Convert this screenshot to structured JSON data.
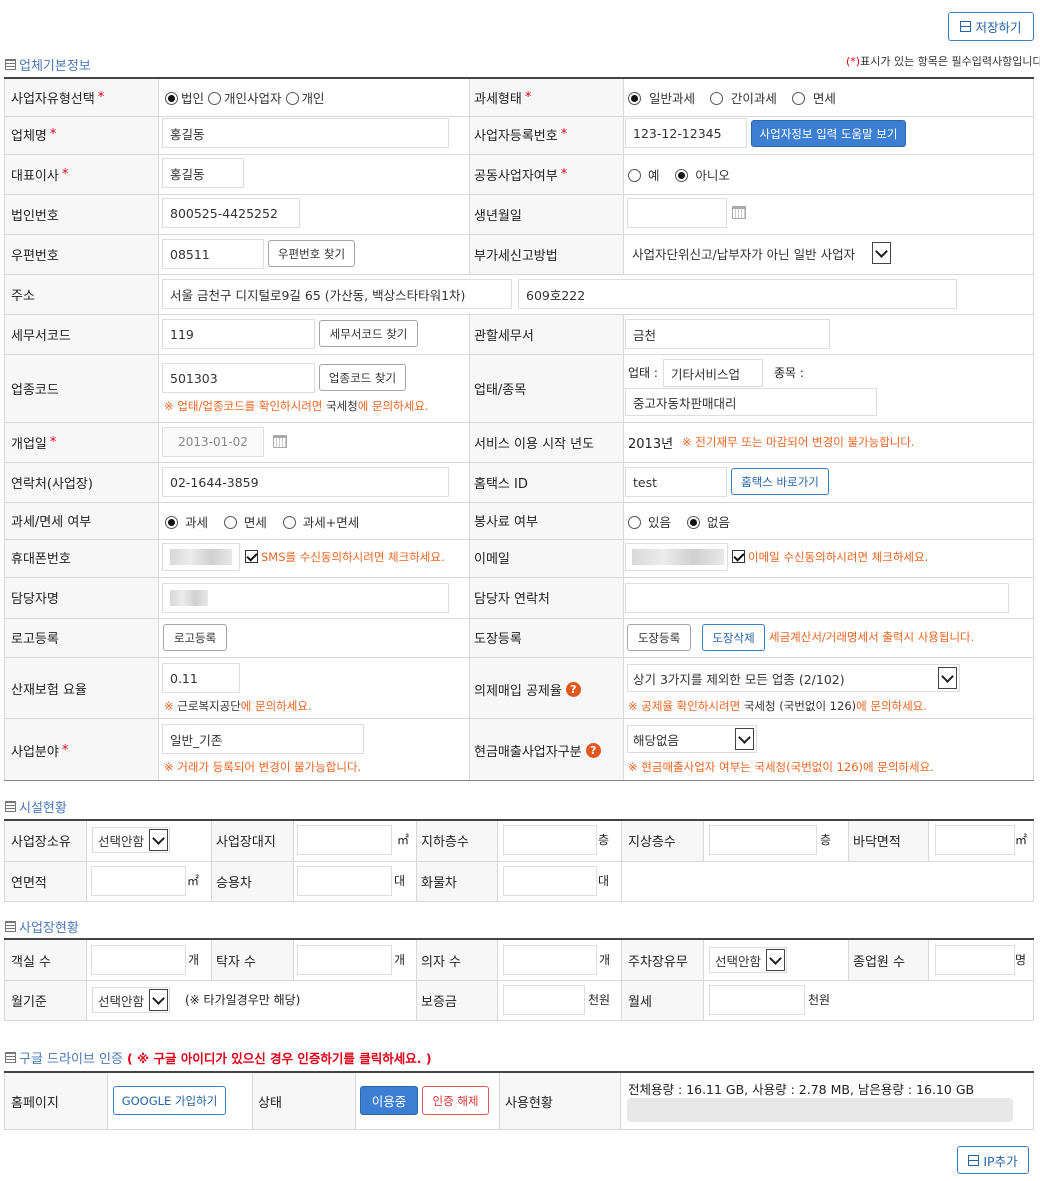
{
  "top": {
    "save_label": "저장하기",
    "required_note_mark": "(*)",
    "required_note_text": "표시가 있는 항목은 필수입력사항입니다."
  },
  "basic": {
    "section_title": "업체기본정보",
    "biz_type_label": "사업자유형선택",
    "biz_type_options": [
      "법인",
      "개인사업자",
      "개인"
    ],
    "tax_type_label": "과세형태",
    "tax_type_options": [
      "일반과세",
      "간이과세",
      "면세"
    ],
    "company_name_label": "업체명",
    "company_name_value": "홍길동",
    "reg_no_label": "사업자등록번호",
    "reg_no_value": "123-12-12345",
    "reg_help_button": "사업자정보 입력 도움말 보기",
    "ceo_label": "대표이사",
    "ceo_value": "홍길동",
    "joint_label": "공동사업자여부",
    "joint_options": [
      "예",
      "아니오"
    ],
    "corp_no_label": "법인번호",
    "corp_no_value": "800525-4425252",
    "birth_label": "생년월일",
    "zip_label": "우편번호",
    "zip_value": "08511",
    "zip_button": "우편번호 찾기",
    "vat_label": "부가세신고방법",
    "vat_value": "사업자단위신고/납부자가 아닌 일반 사업자",
    "address_label": "주소",
    "address1": "서울 금천구 디지털로9길 65 (가산동, 백상스타타워1차)",
    "address2": "609호222",
    "taxoffice_code_label": "세무서코드",
    "taxoffice_code_value": "119",
    "taxoffice_code_button": "세무서코드 찾기",
    "taxoffice_label": "관할세무서",
    "taxoffice_value": "금천",
    "industry_code_label": "업종코드",
    "industry_code_value": "501303",
    "industry_code_button": "업종코드 찾기",
    "industry_note_pre": "※ 업태/업종코드를 확인하시려면 ",
    "industry_note_bold": "국세청",
    "industry_note_post": "에 문의하세요.",
    "biz_item_label": "업태/종목",
    "biz_type_sub": "업태 :",
    "biz_type_value": "기타서비스업",
    "item_sub": "종목 :",
    "item_value": "중고자동차판매대리",
    "open_date_label": "개업일",
    "open_date_value": "2013-01-02",
    "service_year_label": "서비스 이용 시작 년도",
    "service_year_value": "2013년",
    "service_year_note": "※ 전기재무 또는 마감되어 변경이 불가능합니다.",
    "contact_label": "연락처(사업장)",
    "contact_value": "02-1644-3859",
    "hometax_label": "홈택스 ID",
    "hometax_value": "test",
    "hometax_button": "홈택스 바로가기",
    "taxfree_label": "과세/면세 여부",
    "taxfree_options": [
      "과세",
      "면세",
      "과세+면세"
    ],
    "service_fee_label": "봉사료 여부",
    "service_fee_options": [
      "있음",
      "없음"
    ],
    "mobile_label": "휴대폰번호",
    "sms_note": "SMS를 수신동의하시려면 체크하세요.",
    "email_label": "이메일",
    "email_note": "이메일 수신동의하시려면 체크하세요.",
    "manager_label": "담당자명",
    "manager_contact_label": "담당자 연락처",
    "logo_label": "로고등록",
    "logo_button": "로고등록",
    "seal_label": "도장등록",
    "seal_button": "도장등록",
    "seal_delete_button": "도장삭제",
    "seal_note": "세금계산서/거래명세서 출력시 사용됩니다.",
    "insurance_label": "산재보험 요율",
    "insurance_value": "0.11",
    "insurance_note_pre": "※ ",
    "insurance_note_bold": "근로복지공단",
    "insurance_note_post": "에 문의하세요.",
    "deemed_label": "의제매입 공제율",
    "deemed_value": "상기 3가지를 제외한 모든 업종 (2/102)",
    "deemed_note_pre": "※ 공제율 확인하시려면 ",
    "deemed_note_bold": "국세청 (국번없이 126)",
    "deemed_note_post": "에 문의하세요.",
    "field_label": "사업분야",
    "field_value": "일반_기존",
    "field_note": "※ 거래가 등록되어 변경이 불가능합니다.",
    "cash_label": "현금매출사업자구분",
    "cash_value": "해당없음",
    "cash_note": "※ 현금매출사업자 여부는 국세청(국번없이 126)에 문의하세요."
  },
  "facility": {
    "section_title": "시설현황",
    "ownership_label": "사업장소유",
    "ownership_value": "선택안함",
    "land_label": "사업장대지",
    "land_unit": "㎡",
    "basement_label": "지하층수",
    "basement_unit": "층",
    "ground_label": "지상층수",
    "ground_unit": "층",
    "floor_area_label": "바닥면적",
    "floor_area_unit": "㎡",
    "total_area_label": "연면적",
    "total_area_unit": "㎡",
    "car_label": "승용차",
    "car_unit": "대",
    "truck_label": "화물차",
    "truck_unit": "대"
  },
  "workplace": {
    "section_title": "사업장현황",
    "rooms_label": "객실 수",
    "rooms_unit": "개",
    "tables_label": "탁자 수",
    "tables_unit": "개",
    "chairs_label": "의자 수",
    "chairs_unit": "개",
    "parking_label": "주차장유무",
    "parking_value": "선택안함",
    "employees_label": "종업원 수",
    "employees_unit": "명",
    "monthly_label": "월기준",
    "monthly_value": "선택안함",
    "monthly_note": "(※ 타가일경우만 해당)",
    "deposit_label": "보증금",
    "deposit_unit": "천원",
    "rent_label": "월세",
    "rent_unit": "천원"
  },
  "google": {
    "section_title": "구글 드라이브 인증",
    "section_note": "( ※ 구글 아이디가 있으신 경우 인증하기를 클릭하세요. )",
    "homepage_label": "홈페이지",
    "join_button": "GOOGLE 가입하기",
    "status_label": "상태",
    "in_use_button": "이용중",
    "cancel_button": "인증 해제",
    "usage_label": "사용현황",
    "usage_text": "전체용량 : 16.11 GB, 사용량 : 2.78 MB, 남은용량 : 16.10 GB",
    "usage_fraction": 0.0002
  },
  "bottom": {
    "ip_button": "IP추가"
  },
  "colors": {
    "section_head": "#4a78b7",
    "note_orange": "#ee6523",
    "required_red": "#e0001a",
    "primary_blue": "#3c7fd2"
  }
}
